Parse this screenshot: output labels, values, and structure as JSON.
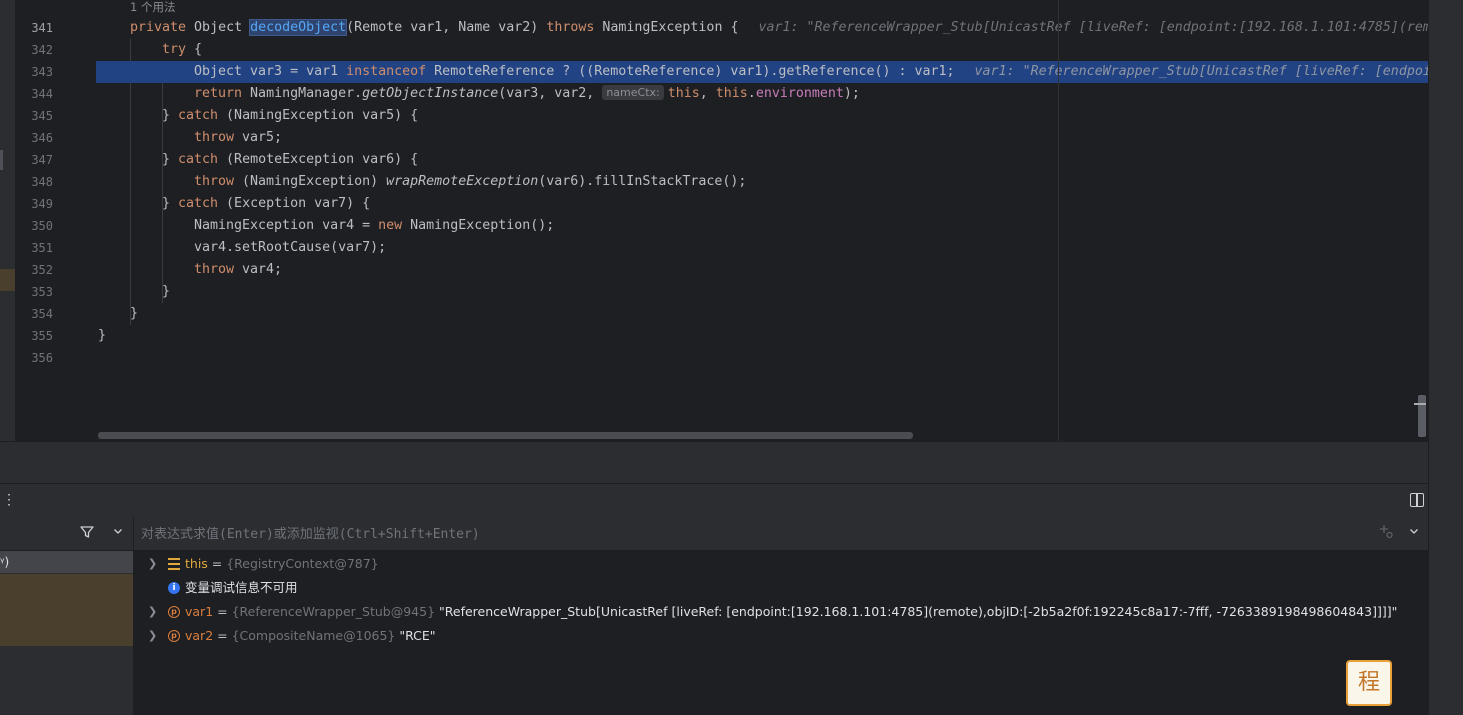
{
  "editor": {
    "usages_hint": "1 个用法",
    "line_numbers": [
      "341",
      "342",
      "343",
      "344",
      "345",
      "346",
      "347",
      "348",
      "349",
      "350",
      "351",
      "352",
      "353",
      "354",
      "355",
      "356"
    ],
    "current_line": "341",
    "code": {
      "l341": {
        "kw_private": "private",
        "type_object": " Object ",
        "method_name": "decodeObject",
        "params": "(Remote var1, Name var2) ",
        "kw_throws": "throws",
        "exc": " NamingException {",
        "inline_hint": "var1: \"ReferenceWrapper_Stub[UnicastRef [liveRef: [endpoint:[192.168.1.101:4785](rem"
      },
      "l342": {
        "kw_try": "try",
        "rest": " {"
      },
      "l343": {
        "a": "Object var3 = var1 ",
        "kw_instanceof": "instanceof",
        "b": " RemoteReference ? ((RemoteReference) var1).getReference() : var1;",
        "inline_hint": "var1: \"ReferenceWrapper_Stub[UnicastRef [liveRef: [endpoi"
      },
      "l344": {
        "kw_return": "return",
        "a": " NamingManager.",
        "method": "getObjectInstance",
        "b": "(var3, var2, ",
        "param_chip": "nameCtx:",
        "kw_this1": "this",
        "c": ", ",
        "kw_this2": "this",
        "d": ".",
        "field": "environment",
        "e": ");"
      },
      "l345": {
        "a": "} ",
        "kw_catch": "catch",
        "b": " (NamingException var5) {"
      },
      "l346": {
        "kw_throw": "throw",
        "b": " var5;"
      },
      "l347": {
        "a": "} ",
        "kw_catch": "catch",
        "b": " (RemoteException var6) {"
      },
      "l348": {
        "kw_throw": "throw",
        "a": " (NamingException) ",
        "method": "wrapRemoteException",
        "b": "(var6).fillInStackTrace();"
      },
      "l349": {
        "a": "} ",
        "kw_catch": "catch",
        "b": " (Exception var7) {"
      },
      "l350": {
        "a": "NamingException var4 = ",
        "kw_new": "new",
        "b": " NamingException();"
      },
      "l351": {
        "a": "var4.setRootCause(var7);"
      },
      "l352": {
        "kw_throw": "throw",
        "b": " var4;"
      },
      "l353": {
        "a": "}"
      },
      "l354": {
        "a": "}"
      },
      "l355": {
        "a": "}"
      }
    }
  },
  "debugger": {
    "menu_dots": "⋮",
    "frames": {
      "filter_icon": "funnel-icon",
      "selected_frame": "ᵞ)"
    },
    "evaluate": {
      "placeholder": "对表达式求值(Enter)或添加监视(Ctrl+Shift+Enter)"
    },
    "variables": [
      {
        "name": "this",
        "eq": " = ",
        "type": "{RegistryContext@787}",
        "value": ""
      },
      {
        "info": "变量调试信息不可用"
      },
      {
        "name": "var1",
        "eq": " = ",
        "type": "{ReferenceWrapper_Stub@945}",
        "value": " \"ReferenceWrapper_Stub[UnicastRef [liveRef: [endpoint:[192.168.1.101:4785](remote),objID:[-2b5a2f0f:192245c8a17:-7fff, -7263389198498604843]]]]\""
      },
      {
        "name": "var2",
        "eq": " = ",
        "type": "{CompositeName@1065}",
        "value": " \"RCE\""
      }
    ],
    "param_badge": "p",
    "info_badge": "i"
  },
  "colors": {
    "background": "#1e1f22",
    "selected_line": "#214283",
    "keyword": "#cf8e6d",
    "method": "#56a8f5",
    "field": "#c77dba"
  }
}
